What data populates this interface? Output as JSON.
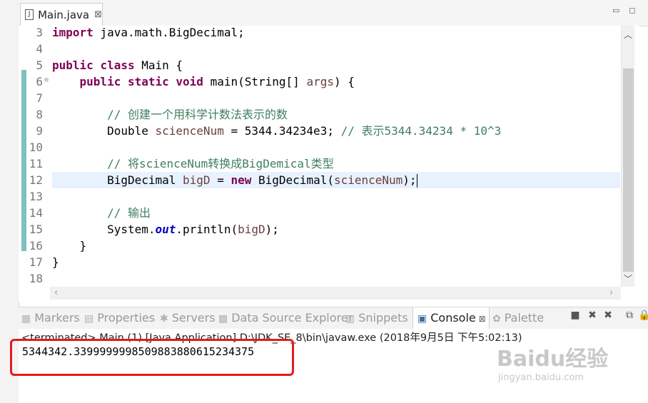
{
  "editor_tab": {
    "title": "Main.java",
    "file_icon": "J",
    "close": "⊠"
  },
  "window_controls": {
    "minimize": "▭",
    "maximize": "◻"
  },
  "lines": [
    {
      "n": "3",
      "tokens": [
        {
          "t": "import",
          "c": "kw"
        },
        {
          "t": " java.math.BigDecimal;",
          "c": ""
        }
      ]
    },
    {
      "n": "4",
      "tokens": []
    },
    {
      "n": "5",
      "tokens": [
        {
          "t": "public",
          "c": "kw"
        },
        {
          "t": " ",
          "c": ""
        },
        {
          "t": "class",
          "c": "kw"
        },
        {
          "t": " Main {",
          "c": ""
        }
      ]
    },
    {
      "n": "6",
      "fold": "⊖",
      "tokens": [
        {
          "t": "    ",
          "c": ""
        },
        {
          "t": "public",
          "c": "kw"
        },
        {
          "t": " ",
          "c": ""
        },
        {
          "t": "static",
          "c": "kw"
        },
        {
          "t": " ",
          "c": ""
        },
        {
          "t": "void",
          "c": "kw"
        },
        {
          "t": " main(String[] ",
          "c": ""
        },
        {
          "t": "args",
          "c": "var"
        },
        {
          "t": ") {",
          "c": ""
        }
      ]
    },
    {
      "n": "7",
      "tokens": []
    },
    {
      "n": "8",
      "tokens": [
        {
          "t": "        ",
          "c": ""
        },
        {
          "t": "// 创建一个用科学计数法表示的数",
          "c": "cm"
        }
      ]
    },
    {
      "n": "9",
      "tokens": [
        {
          "t": "        Double ",
          "c": ""
        },
        {
          "t": "scienceNum",
          "c": "var"
        },
        {
          "t": " = 5344.34234e3; ",
          "c": ""
        },
        {
          "t": "// 表示5344.34234 * 10^3",
          "c": "cm"
        }
      ]
    },
    {
      "n": "10",
      "tokens": []
    },
    {
      "n": "11",
      "tokens": [
        {
          "t": "        ",
          "c": ""
        },
        {
          "t": "// 将scienceNum转换成BigDemical类型",
          "c": "cm"
        }
      ]
    },
    {
      "n": "12",
      "highlight": true,
      "caret": true,
      "tokens": [
        {
          "t": "        BigDecimal ",
          "c": ""
        },
        {
          "t": "bigD",
          "c": "var"
        },
        {
          "t": " = ",
          "c": ""
        },
        {
          "t": "new",
          "c": "kw"
        },
        {
          "t": " BigDecimal(",
          "c": ""
        },
        {
          "t": "scienceNum",
          "c": "var"
        },
        {
          "t": ");",
          "c": ""
        }
      ]
    },
    {
      "n": "13",
      "tokens": []
    },
    {
      "n": "14",
      "tokens": [
        {
          "t": "        ",
          "c": ""
        },
        {
          "t": "// 输出",
          "c": "cm"
        }
      ]
    },
    {
      "n": "15",
      "tokens": [
        {
          "t": "        System.",
          "c": ""
        },
        {
          "t": "out",
          "c": "st"
        },
        {
          "t": ".println(",
          "c": ""
        },
        {
          "t": "bigD",
          "c": "var"
        },
        {
          "t": ");",
          "c": ""
        }
      ]
    },
    {
      "n": "16",
      "tokens": [
        {
          "t": "    }",
          "c": ""
        }
      ]
    },
    {
      "n": "17",
      "tokens": [
        {
          "t": "}",
          "c": ""
        }
      ]
    },
    {
      "n": "18",
      "tokens": []
    }
  ],
  "view_tabs": [
    {
      "label": "Markers",
      "icon": "markers-icon",
      "active": false
    },
    {
      "label": "Properties",
      "icon": "properties-icon",
      "active": false
    },
    {
      "label": "Servers",
      "icon": "servers-icon",
      "active": false
    },
    {
      "label": "Data Source Explorer",
      "icon": "data-source-icon",
      "active": false
    },
    {
      "label": "Snippets",
      "icon": "snippets-icon",
      "active": false
    },
    {
      "label": "Console",
      "icon": "console-icon",
      "active": true,
      "close": "⊠"
    },
    {
      "label": "Palette",
      "icon": "palette-icon",
      "active": false
    }
  ],
  "toolbar_icons": [
    "stop-icon",
    "remove-launch-icon",
    "remove-all-icon",
    "scroll-lock-icon",
    "pin-icon"
  ],
  "console": {
    "terminated": "<terminated> Main (1) [Java Application] D:\\JDK_SE_8\\bin\\javaw.exe (2018年9月5日 下午5:02:13)",
    "output": "5344342.339999999850988388061523437​5"
  },
  "watermark": {
    "brand": "Baidu经验",
    "url": "jingyan.baidu.com"
  },
  "colors": {
    "keyword": "#7f0055",
    "comment": "#3f7f5f",
    "variable": "#6a3e3e",
    "static_field": "#0000c0",
    "highlight": "#e8f2fe",
    "annotation": "#e11d1d"
  }
}
